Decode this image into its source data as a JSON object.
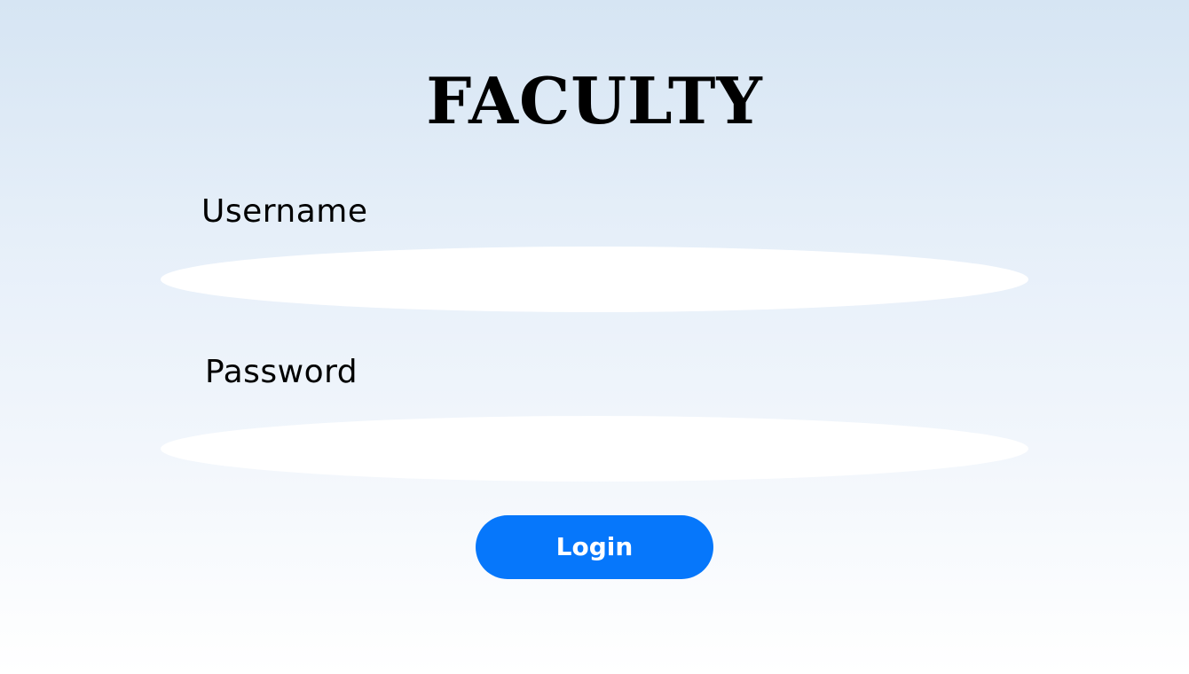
{
  "page": {
    "title": "FACULTY"
  },
  "form": {
    "username_label": "Username",
    "username_value": "",
    "password_label": "Password",
    "password_value": "",
    "login_label": "Login"
  },
  "colors": {
    "accent": "#0677fb",
    "background_top": "#d6e5f3",
    "background_bottom": "#ffffff"
  }
}
